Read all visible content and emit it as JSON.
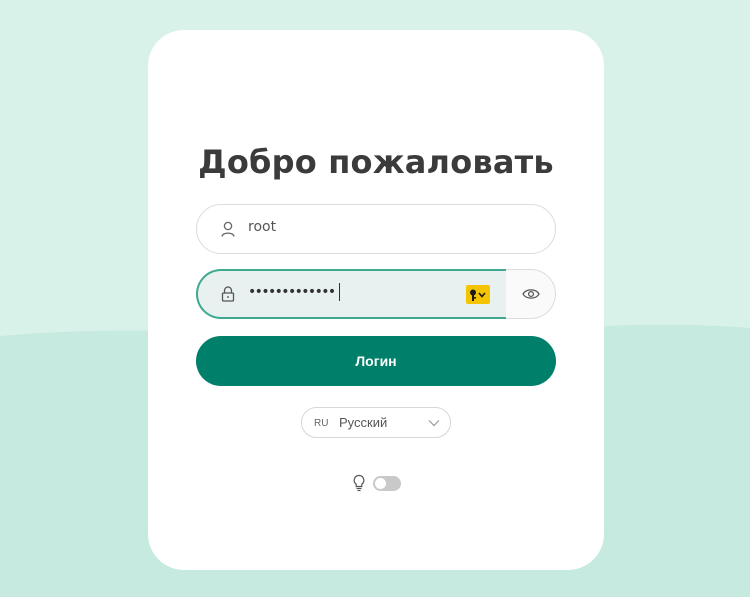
{
  "page": {
    "title": "Добро пожаловать"
  },
  "login_form": {
    "username": {
      "value": "root",
      "icon": "user-icon"
    },
    "password": {
      "masked_value": "•••••••••••••",
      "icon": "lock-icon",
      "manager_icon": "key-icon"
    },
    "show_password_icon": "eye-icon",
    "submit_label": "Логин"
  },
  "language": {
    "code": "RU",
    "label": "Русский"
  },
  "theme": {
    "icon": "lightbulb-icon",
    "dark_mode": false
  },
  "colors": {
    "accent": "#00806a",
    "focus_border": "#3fa891",
    "background": "#d8f2ea",
    "background_lower": "#c6e9e0",
    "key_badge": "#f5c400"
  }
}
